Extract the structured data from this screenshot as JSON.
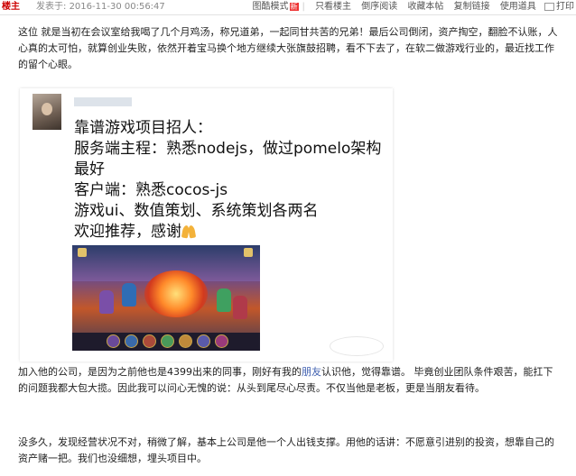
{
  "header": {
    "louzhu": "楼主",
    "posted_label": "发表于:",
    "posted_time": "2016-11-30 00:56:47",
    "tools": {
      "image_mode": "图酷模式",
      "new_badge": "新",
      "only_louzhu": "只看楼主",
      "reverse_read": "倒序阅读",
      "favorite": "收藏本帖",
      "copy_link": "复制链接",
      "use_tool": "使用道具",
      "print": "打印"
    }
  },
  "paragraphs": {
    "p1": "这位   就是当初在会议室给我喝了几个月鸡汤，称兄道弟，一起同甘共苦的兄弟！最后公司倒闭，资产掏空，翻脸不认账，人心真的太可怕，就算创业失败，依然开着宝马换个地方继续大张旗鼓招聘，看不下去了，在软二做游戏行业的，最近找工作的留个心眼。",
    "p2_a": "加入他的公司，是因为之前他也是4399出来的同事，刚好有我的",
    "p2_link": "朋友",
    "p2_b": "认识他，觉得靠谱。 毕竟创业团队条件艰苦，能扛下的问题我都大包大揽。因此我可以问心无愧的说：从头到尾尽心尽责。不仅当他是老板，更是当朋友看待。",
    "p3": "没多久，发现经营状况不对，稍微了解，基本上公司是他一个人出钱支撑。用他的话讲：不愿意引进别的投资，想靠自己的资产赌一把。我们也没细想，埋头项目中。"
  },
  "moment_card": {
    "lines": [
      "靠谱游戏项目招人：",
      "服务端主程：熟悉nodejs，做过pomelo架构",
      "最好",
      "客户端：熟悉cocos-js",
      "游戏ui、数值策划、系统策划各两名",
      "欢迎推荐，感谢"
    ]
  }
}
